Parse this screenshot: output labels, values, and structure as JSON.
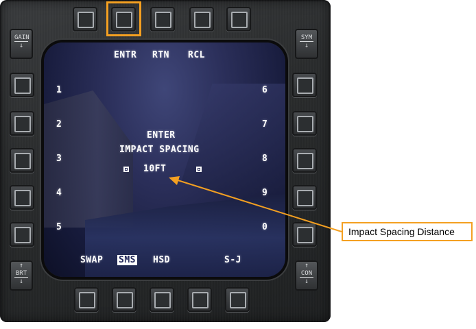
{
  "top_labels": {
    "osb1": "ENTR",
    "osb2": "RTN",
    "osb3": "RCL"
  },
  "left_labels": [
    "1",
    "2",
    "3",
    "4",
    "5"
  ],
  "right_labels": [
    "6",
    "7",
    "8",
    "9",
    "0"
  ],
  "bottom_labels": {
    "swap": "SWAP",
    "sms": "SMS",
    "hsd": "HSD",
    "sj": "S-J"
  },
  "center": {
    "line1": "ENTER",
    "line2": "IMPACT SPACING",
    "value": "10FT"
  },
  "rockers": {
    "gain": "GAIN",
    "sym": "SYM",
    "brt": "BRT",
    "con": "CON",
    "up": "↑",
    "down": "↓"
  },
  "callout": {
    "text": "Impact Spacing Distance"
  },
  "colors": {
    "highlight": "#f4a021",
    "display_text": "#ffffff",
    "screen": "#2b2f5a"
  }
}
